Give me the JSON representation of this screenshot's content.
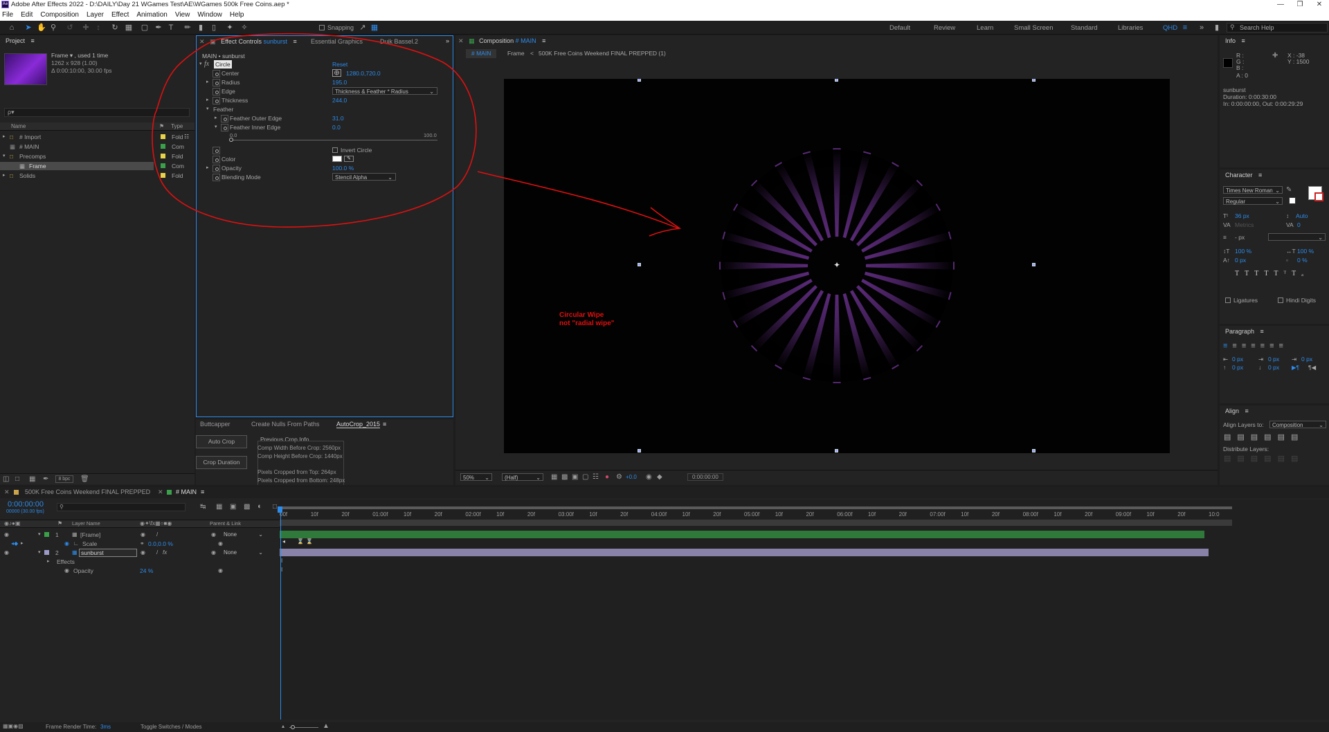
{
  "window": {
    "title": "Adobe After Effects 2022 - D:\\DAILY\\Day 21 WGames Test\\AE\\WGames 500k Free Coins.aep *",
    "app_icon": "Ae"
  },
  "menu": [
    "File",
    "Edit",
    "Composition",
    "Layer",
    "Effect",
    "Animation",
    "View",
    "Window",
    "Help"
  ],
  "toolbar": {
    "snapping": "Snapping",
    "workspaces": [
      "Default",
      "Review",
      "Learn",
      "Small Screen",
      "Standard",
      "Libraries",
      "QHD"
    ],
    "search": "Search Help"
  },
  "project": {
    "title": "Project",
    "item_name": "Frame ▾ , used 1 time",
    "item_size": "1262 x 928 (1.00)",
    "item_duration": "Δ 0:00:10:00, 30.00 fps",
    "search_placeholder": "ρ▾",
    "col_name": "Name",
    "col_type": "Type",
    "items": [
      {
        "name": "# Import",
        "type": "Fold",
        "color": "#e8d24a"
      },
      {
        "name": "# MAIN",
        "type": "Com",
        "color": "#3aa04a"
      },
      {
        "name": "Precomps",
        "type": "Fold",
        "color": "#e8d24a"
      },
      {
        "name": "Frame",
        "type": "Com",
        "color": "#3aa04a"
      },
      {
        "name": "Solids",
        "type": "Fold",
        "color": "#e8d24a"
      }
    ],
    "bpc": "8 bpc"
  },
  "effect_controls": {
    "tab": "Effect Controls",
    "layer": "sunburst",
    "tab2": "Essential Graphics",
    "tab3": "Duik Bassel.2",
    "path": "MAIN • sunburst",
    "effect": "Circle",
    "reset": "Reset",
    "props": [
      {
        "name": "Center",
        "value": "1280.0,720.0"
      },
      {
        "name": "Radius",
        "value": "195.0"
      },
      {
        "name": "Edge",
        "value": "Thickness & Feather * Radius"
      },
      {
        "name": "Thickness",
        "value": "244.0"
      },
      {
        "name": "Feather",
        "value": ""
      },
      {
        "name": "Feather Outer Edge",
        "value": "31.0"
      },
      {
        "name": "Feather Inner Edge",
        "value": "0.0"
      },
      {
        "name": "Invert Circle",
        "value": ""
      },
      {
        "name": "Color",
        "value": ""
      },
      {
        "name": "Opacity",
        "value": "100.0 %"
      },
      {
        "name": "Blending Mode",
        "value": "Stencil Alpha"
      }
    ],
    "slider_min": "0.0",
    "slider_max": "100.0"
  },
  "autocrop": {
    "tabs": [
      "Buttcapper",
      "Create Nulls From Paths",
      "AutoCrop_2015"
    ],
    "auto_crop": "Auto Crop",
    "crop_duration": "Crop Duration",
    "info_title": "Previous Crop Info",
    "lines": [
      "Comp Width Before Crop: 2560px",
      "Comp Height Before Crop: 1440px",
      "Pixels Cropped from Top: 264px",
      "Pixels Cropped from Bottom: 248px"
    ]
  },
  "composition": {
    "title": "Composition",
    "comp_name": "# MAIN",
    "crumbs": [
      "# MAIN",
      "Frame",
      "500K Free Coins Weekend FINAL PREPPED (1)"
    ],
    "annotation_line1": "Circular Wipe",
    "annotation_line2": "not \"radial wipe\"",
    "zoom": "50%",
    "quality": "(Half)",
    "exposure": "+0.0",
    "timecode": "0:00:00:00"
  },
  "info": {
    "title": "Info",
    "r": "R :",
    "g": "G :",
    "b": "B :",
    "a": "A : 0",
    "x": "X : -38",
    "y": "Y : 1500",
    "layer": "sunburst",
    "duration": "Duration: 0:00:30:00",
    "inout": "In: 0:00:00:00, Out: 0:00:29:29"
  },
  "character": {
    "title": "Character",
    "font": "Times New Roman",
    "style": "Regular",
    "size": "36 px",
    "leading": "Auto",
    "kerning": "Metrics",
    "tracking": "0",
    "stroke": "- px",
    "vscale": "100 %",
    "hscale": "100 %",
    "baseline": "0 px",
    "tsume": "0 %",
    "ligatures": "Ligatures",
    "hindi": "Hindi Digits"
  },
  "paragraph": {
    "title": "Paragraph",
    "values": [
      "0 px",
      "0 px",
      "0 px",
      "0 px",
      "0 px"
    ]
  },
  "align": {
    "title": "Align",
    "align_to_label": "Align Layers to:",
    "align_to": "Composition",
    "distribute": "Distribute Layers:"
  },
  "timeline": {
    "tabs": [
      "500K Free Coins Weekend FINAL PREPPED",
      "# MAIN"
    ],
    "timecode": "0:00:00:00",
    "fps": "00000 (30.00 fps)",
    "col_layer": "Layer Name",
    "col_parent": "Parent & Link",
    "ruler": [
      "00f",
      "10f",
      "20f",
      "01:00f",
      "10f",
      "20f",
      "02:00f",
      "10f",
      "20f",
      "03:00f",
      "10f",
      "20f",
      "04:00f",
      "10f",
      "20f",
      "05:00f",
      "10f",
      "20f",
      "06:00f",
      "10f",
      "20f",
      "07:00f",
      "10f",
      "20f",
      "08:00f",
      "10f",
      "20f",
      "09:00f",
      "10f",
      "20f",
      "10:0"
    ],
    "layers": [
      {
        "num": "1",
        "name": "[Frame]",
        "parent": "None"
      },
      {
        "num": "2",
        "name": "sunburst",
        "parent": "None"
      }
    ],
    "scale_label": "Scale",
    "scale_value": "0.0,0.0 %",
    "effects_label": "Effects",
    "opacity_label": "Opacity",
    "opacity_value": "24 %",
    "footer_render": "Frame Render Time:",
    "footer_time": "3ms",
    "footer_toggle": "Toggle Switches / Modes"
  },
  "colors": {
    "accent": "#2d8ceb",
    "annotation": "#e01010",
    "burst": "#5a2a78"
  }
}
